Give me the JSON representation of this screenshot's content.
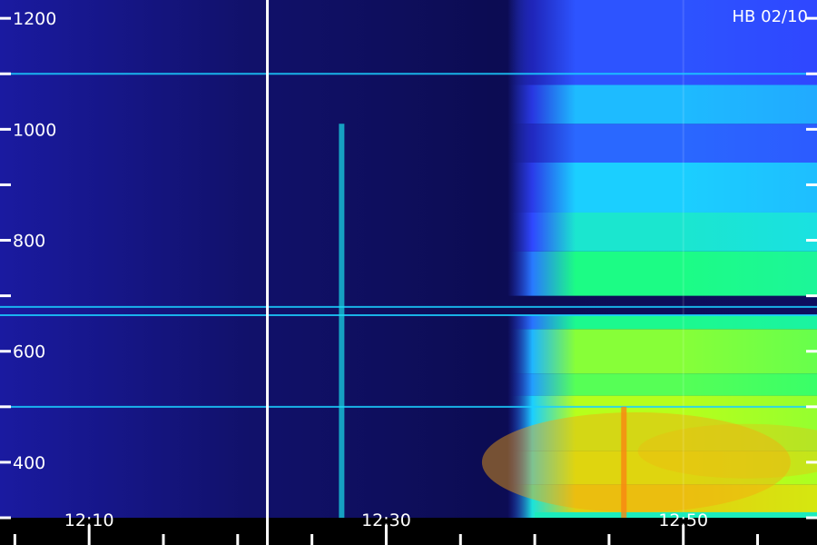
{
  "chart_data": {
    "type": "heatmap",
    "title": "",
    "xlabel": "",
    "ylabel": "",
    "station_label": "HB 02/10",
    "colormap": [
      "#05052a",
      "#1a1aa0",
      "#2f45ff",
      "#1ad8ff",
      "#1cff7a",
      "#c8ff10",
      "#ff9a10",
      "#d81a1a"
    ],
    "axis_color": "#ffffff",
    "x_axis": {
      "unit": "time",
      "range": [
        "12:04",
        "12:59"
      ],
      "tick_labels": [
        "12:10",
        "12:30",
        "12:50"
      ],
      "major_ticks": [
        "12:10",
        "12:30",
        "12:50"
      ],
      "minor_ticks": [
        "12:05",
        "12:15",
        "12:20",
        "12:25",
        "12:35",
        "12:40",
        "12:45",
        "12:55"
      ],
      "data_gap_marker": "12:22"
    },
    "y_axis": {
      "range": [
        300,
        1233
      ],
      "tick_labels": [
        "400",
        "600",
        "800",
        "1000",
        "1200"
      ],
      "label_values": [
        400,
        600,
        800,
        1000,
        1200
      ],
      "tick_values": [
        300,
        400,
        500,
        600,
        700,
        800,
        900,
        1000,
        1100,
        1200
      ]
    },
    "features": {
      "onset_time": "12:40",
      "spectrogram_step_time": "12:50",
      "spike_times": [
        "12:27",
        "12:46"
      ],
      "interference_lines": [
        680,
        665,
        500,
        1100
      ],
      "intensity_bands": [
        {
          "low": 300,
          "high": 360,
          "level": 0.78
        },
        {
          "low": 360,
          "high": 420,
          "level": 0.72
        },
        {
          "low": 420,
          "high": 520,
          "level": 0.7
        },
        {
          "low": 520,
          "high": 560,
          "level": 0.62
        },
        {
          "low": 560,
          "high": 640,
          "level": 0.66
        },
        {
          "low": 640,
          "high": 665,
          "level": 0.55
        },
        {
          "low": 700,
          "high": 780,
          "level": 0.56
        },
        {
          "low": 780,
          "high": 850,
          "level": 0.48
        },
        {
          "low": 850,
          "high": 940,
          "level": 0.42
        },
        {
          "low": 940,
          "high": 1010,
          "level": 0.32
        },
        {
          "low": 1010,
          "high": 1080,
          "level": 0.4
        },
        {
          "low": 1080,
          "high": 1233,
          "level": 0.3
        }
      ]
    }
  }
}
